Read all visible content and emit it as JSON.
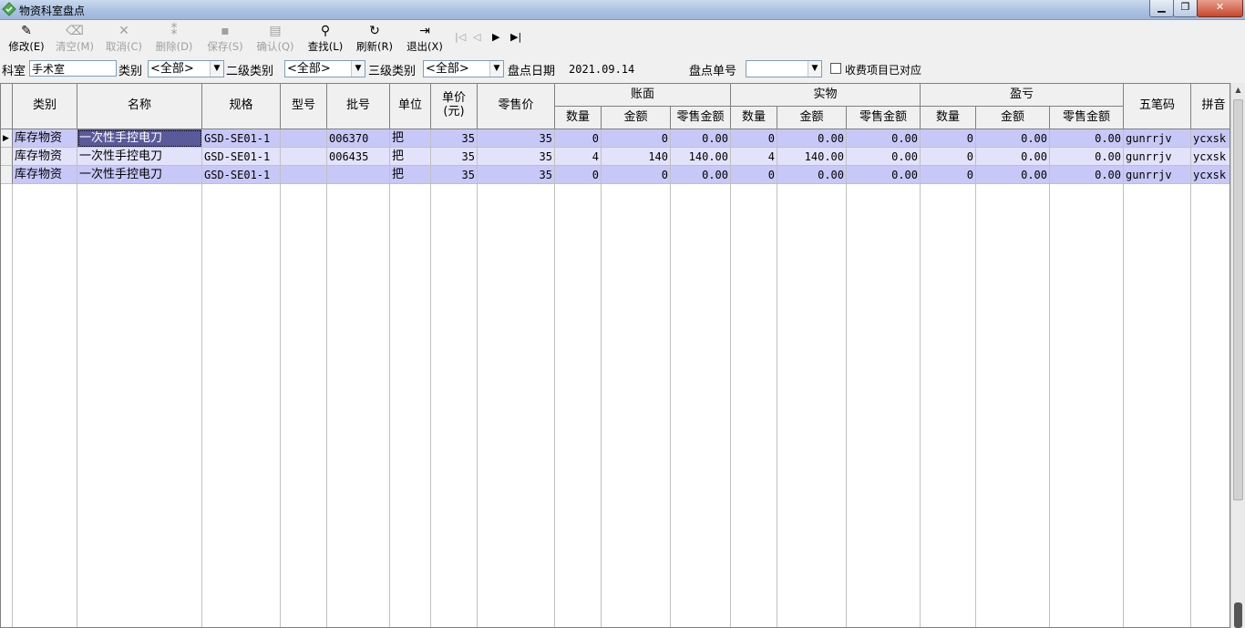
{
  "window": {
    "title": "物资科室盘点",
    "min": "▁",
    "max": "❐",
    "close": "✕"
  },
  "toolbar": {
    "buttons": [
      {
        "label": "修改(E)",
        "icon": "edit-icon",
        "glyph": "✎",
        "enabled": true
      },
      {
        "label": "清空(M)",
        "icon": "clear-icon",
        "glyph": "⌫",
        "enabled": false
      },
      {
        "label": "取消(C)",
        "icon": "cancel-icon",
        "glyph": "✕",
        "enabled": false
      },
      {
        "label": "删除(D)",
        "icon": "delete-icon",
        "glyph": "⁑",
        "enabled": false
      },
      {
        "label": "保存(S)",
        "icon": "save-icon",
        "glyph": "▪",
        "enabled": false
      },
      {
        "label": "确认(Q)",
        "icon": "confirm-icon",
        "glyph": "▤",
        "enabled": false
      },
      {
        "label": "查找(L)",
        "icon": "search-icon",
        "glyph": "⚲",
        "enabled": true
      },
      {
        "label": "刷新(R)",
        "icon": "refresh-icon",
        "glyph": "↻",
        "enabled": true
      },
      {
        "label": "退出(X)",
        "icon": "exit-icon",
        "glyph": "⇥",
        "enabled": true
      }
    ],
    "nav": [
      "|◁",
      "◁",
      "▶",
      "▶|"
    ]
  },
  "filter": {
    "dept_label": "科室",
    "dept_value": "手术室",
    "category_label": "类别",
    "category_value": "<全部>",
    "level2_label": "二级类别",
    "level2_value": "<全部>",
    "level3_label": "三级类别",
    "level3_value": "<全部>",
    "date_label": "盘点日期",
    "date_value": "2021.09.14",
    "order_label": "盘点单号",
    "order_value": "",
    "charge_label": "收费项目已对应",
    "charge_checked": false
  },
  "grid": {
    "headers": {
      "category": "类别",
      "name": "名称",
      "spec": "规格",
      "model": "型号",
      "batch": "批号",
      "unit": "单位",
      "unit_price": "单价(元)",
      "retail_price": "零售价",
      "book": "账面",
      "real": "实物",
      "diff": "盈亏",
      "qty": "数量",
      "amount": "金额",
      "retail_amount": "零售金额",
      "wubi": "五笔码",
      "pinyin": "拼音"
    },
    "rows": [
      {
        "category": "库存物资",
        "name": "一次性手控电刀",
        "spec": "GSD-SE01-1",
        "model": "",
        "batch": "006370",
        "unit": "把",
        "unit_price": "35",
        "retail_price": "35",
        "book_qty": "0",
        "book_amount": "0",
        "book_retail": "0.00",
        "real_qty": "0",
        "real_amount": "0.00",
        "real_retail": "0.00",
        "diff_qty": "0",
        "diff_amount": "0.00",
        "diff_retail": "0.00",
        "wubi": "gunrrjv",
        "pinyin": "ycxsk"
      },
      {
        "category": "库存物资",
        "name": "一次性手控电刀",
        "spec": "GSD-SE01-1",
        "model": "",
        "batch": "006435",
        "unit": "把",
        "unit_price": "35",
        "retail_price": "35",
        "book_qty": "4",
        "book_amount": "140",
        "book_retail": "140.00",
        "real_qty": "4",
        "real_amount": "140.00",
        "real_retail": "0.00",
        "diff_qty": "0",
        "diff_amount": "0.00",
        "diff_retail": "0.00",
        "wubi": "gunrrjv",
        "pinyin": "ycxsk"
      },
      {
        "category": "库存物资",
        "name": "一次性手控电刀",
        "spec": "GSD-SE01-1",
        "model": "",
        "batch": "",
        "unit": "把",
        "unit_price": "35",
        "retail_price": "35",
        "book_qty": "0",
        "book_amount": "0",
        "book_retail": "0.00",
        "real_qty": "0",
        "real_amount": "0.00",
        "real_retail": "0.00",
        "diff_qty": "0",
        "diff_amount": "0.00",
        "diff_retail": "0.00",
        "wubi": "gunrrjv",
        "pinyin": "ycxsk"
      }
    ],
    "row_colors": [
      "#c8c8f8",
      "#e2e2fb",
      "#c8c8f8"
    ],
    "current_row_marker": "▶"
  }
}
